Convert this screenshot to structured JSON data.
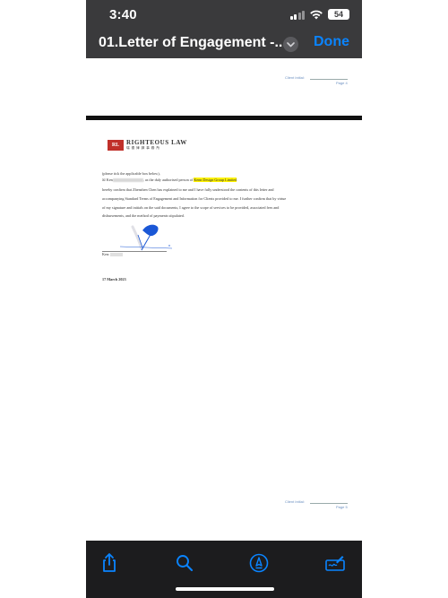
{
  "status_bar": {
    "time": "3:40",
    "battery": "54"
  },
  "nav": {
    "title": "01.Letter of Engagement -...",
    "done_label": "Done"
  },
  "page4_footer": {
    "initial_label": "Client Initial:",
    "page_label": "Page 4"
  },
  "letterhead": {
    "name": "RIGHTEOUS LAW",
    "name_cn": "瑞 德 律 師 事 務 所",
    "mark": "RL"
  },
  "body": {
    "instruction": "(please tick the applicable box below),",
    "line1_prefix": "☒ Ken",
    "line1_mid": ", as the duly authorised person of",
    "company": "Kenn Design Group Limited",
    "line2": "hereby confirm that Zhenzhen Chen has explained to me and I have fully understood the contents of this letter and",
    "line3": "accompanying Standard Terms of Engagement and Information for Clients provided to me. I further confirm that by virtue",
    "line4": "of my signature and initials on the said documents, I agree to the scope of services to be provided, associated fees and",
    "line5": "disbursements, and the method of payments stipulated.",
    "signer_label": "Ken:",
    "date": "17 March 2023"
  },
  "page5_footer": {
    "initial_label": "Client Initial:",
    "page_label": "Page 5"
  },
  "colors": {
    "accent": "#0a84ff",
    "highlight": "#fff200",
    "logo_red": "#c0302a",
    "signature_blue": "#1a57d6"
  },
  "toolbar": {
    "share": "share-icon",
    "search": "search-icon",
    "markup": "markup-pen-icon",
    "signature": "signature-icon"
  }
}
